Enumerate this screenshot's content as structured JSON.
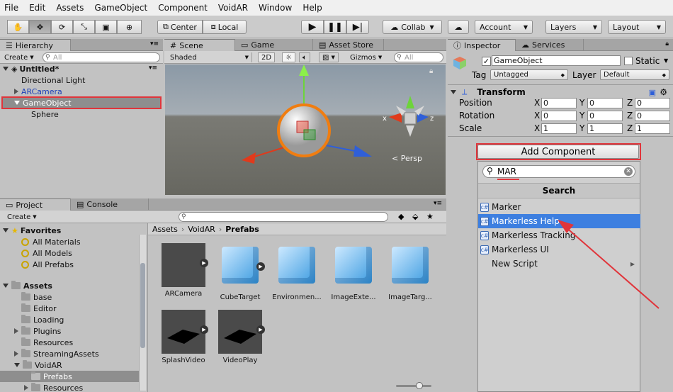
{
  "menu": [
    "File",
    "Edit",
    "Assets",
    "GameObject",
    "Component",
    "VoidAR",
    "Window",
    "Help"
  ],
  "toolbar": {
    "center": "Center",
    "local": "Local",
    "collab": "Collab",
    "account": "Account",
    "layers": "Layers",
    "layout": "Layout"
  },
  "hierarchy": {
    "tab": "Hierarchy",
    "create": "Create",
    "search": "All",
    "scene_name": "Untitled*",
    "items": [
      "Directional Light",
      "ARCamera",
      "GameObject",
      "Sphere"
    ]
  },
  "scene": {
    "tabs": [
      "Scene",
      "Game",
      "Asset Store"
    ],
    "shading": "Shaded",
    "mode_2d": "2D",
    "gizmos": "Gizmos",
    "search": "All",
    "persp": "Persp",
    "axis_x": "x",
    "axis_z": "z"
  },
  "project": {
    "tabs": [
      "Project",
      "Console"
    ],
    "create": "Create",
    "breadcrumb": [
      "Assets",
      "VoidAR",
      "Prefabs"
    ],
    "favorites_title": "Favorites",
    "favorites": [
      "All Materials",
      "All Models",
      "All Prefabs"
    ],
    "assets_title": "Assets",
    "folders": [
      "base",
      "Editor",
      "Loading",
      "Plugins",
      "Resources",
      "StreamingAssets",
      "VoidAR",
      "Prefabs",
      "Resources"
    ],
    "grid": [
      "ARCamera",
      "CubeTarget",
      "Environmen...",
      "ImageExte...",
      "ImageTarg...",
      "SplashVideo",
      "VideoPlay"
    ]
  },
  "inspector": {
    "tabs": [
      "Inspector",
      "Services"
    ],
    "object_name": "GameObject",
    "static_label": "Static",
    "tag_label": "Tag",
    "tag_value": "Untagged",
    "layer_label": "Layer",
    "layer_value": "Default",
    "transform_title": "Transform",
    "rows": [
      {
        "label": "Position",
        "x": "0",
        "y": "0",
        "z": "0"
      },
      {
        "label": "Rotation",
        "x": "0",
        "y": "0",
        "z": "0"
      },
      {
        "label": "Scale",
        "x": "1",
        "y": "1",
        "z": "1"
      }
    ],
    "axis": {
      "x": "X",
      "y": "Y",
      "z": "Z"
    },
    "add_component": "Add Component",
    "search_value": "MAR",
    "popup_title": "Search",
    "results": [
      "Marker",
      "Markerless Help",
      "Markerless Tracking",
      "Markerless UI"
    ],
    "new_script": "New Script"
  },
  "colors": {
    "accent": "#3d7fe0",
    "highlight": "#e0353b"
  }
}
